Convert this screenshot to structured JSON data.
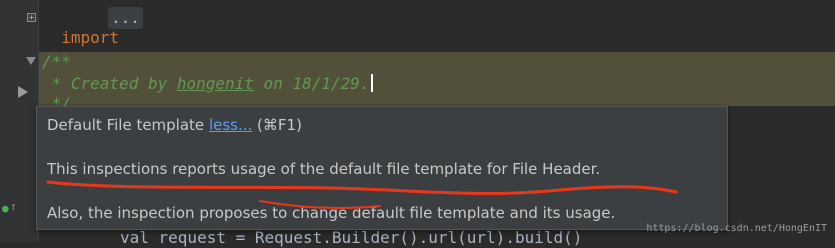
{
  "editor": {
    "line_import_keyword": "import",
    "line_import_collapsed": "...",
    "doc_open": "/**",
    "doc_created_prefix": " * Created by ",
    "doc_author": "hongenit",
    "doc_created_suffix": " on 18/1/29.",
    "doc_close": " */",
    "bottom_code": "val request = Request.Builder().url(url).build()"
  },
  "tooltip": {
    "title_prefix": "Default File template ",
    "title_link": "less...",
    "title_shortcut": " (⌘F1)",
    "line1": "This inspections reports usage of the default file template for File Header.",
    "line2": "Also, the inspection proposes to change default file template and its usage."
  },
  "watermark": "https://blog.csdn.net/HongEnIT",
  "colors": {
    "editor_bg": "#2b2b2b",
    "keyword": "#cc7832",
    "doc_comment": "#629755",
    "warning_highlight": "#52503a",
    "tooltip_bg": "#3c3f41",
    "link": "#589df6",
    "annotation_red": "#e8381c"
  }
}
